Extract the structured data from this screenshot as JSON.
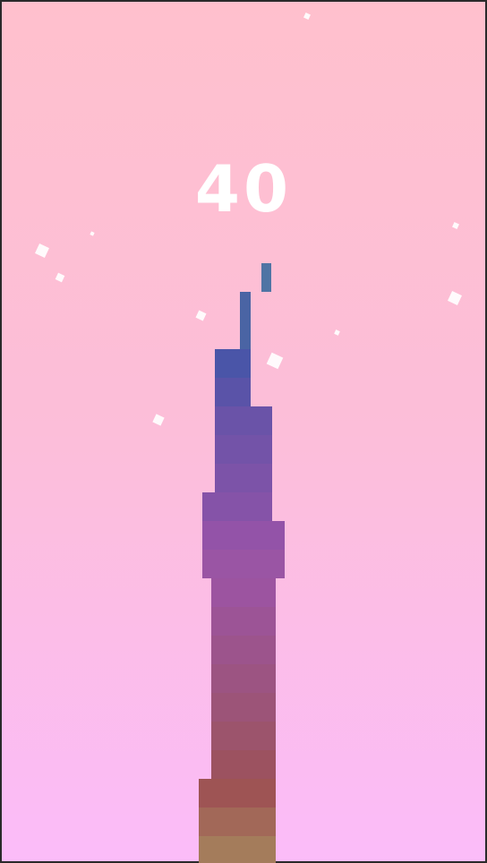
{
  "game": {
    "score": "40"
  },
  "colors": {
    "background_top": "#ffc0cd",
    "background_bottom": "#fbbcf9",
    "score_text": "#ffffff",
    "particle": "#ffffff",
    "falling_block": "#4f74a4",
    "tower_top": "#4a55a8",
    "tower_mid": "#9a55a8",
    "tower_bottom": "#a47c5b"
  }
}
